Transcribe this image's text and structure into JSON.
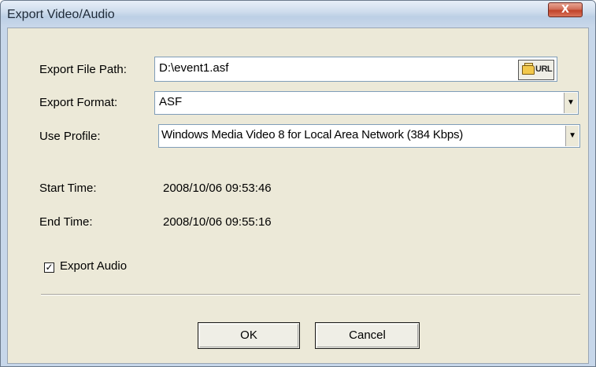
{
  "window": {
    "title": "Export Video/Audio",
    "close_glyph": "X"
  },
  "form": {
    "file_path_label": "Export File Path:",
    "file_path_value": "D:\\event1.asf",
    "url_button_label": "URL",
    "url_button_icon": "folder-open-icon",
    "format_label": "Export Format:",
    "format_value": "ASF",
    "profile_label": "Use Profile:",
    "profile_value": "Windows Media Video 8 for Local Area Network (384 Kbps)",
    "start_time_label": "Start Time:",
    "start_time_value": "2008/10/06 09:53:46",
    "end_time_label": "End Time:",
    "end_time_value": "2008/10/06 09:55:16",
    "export_audio_label": "Export Audio",
    "export_audio_checked": true
  },
  "buttons": {
    "ok_label": "OK",
    "cancel_label": "Cancel"
  },
  "colors": {
    "dialog_face": "#ece9d8",
    "title_bar": "#c7d7ea",
    "close_button": "#c0432a"
  }
}
